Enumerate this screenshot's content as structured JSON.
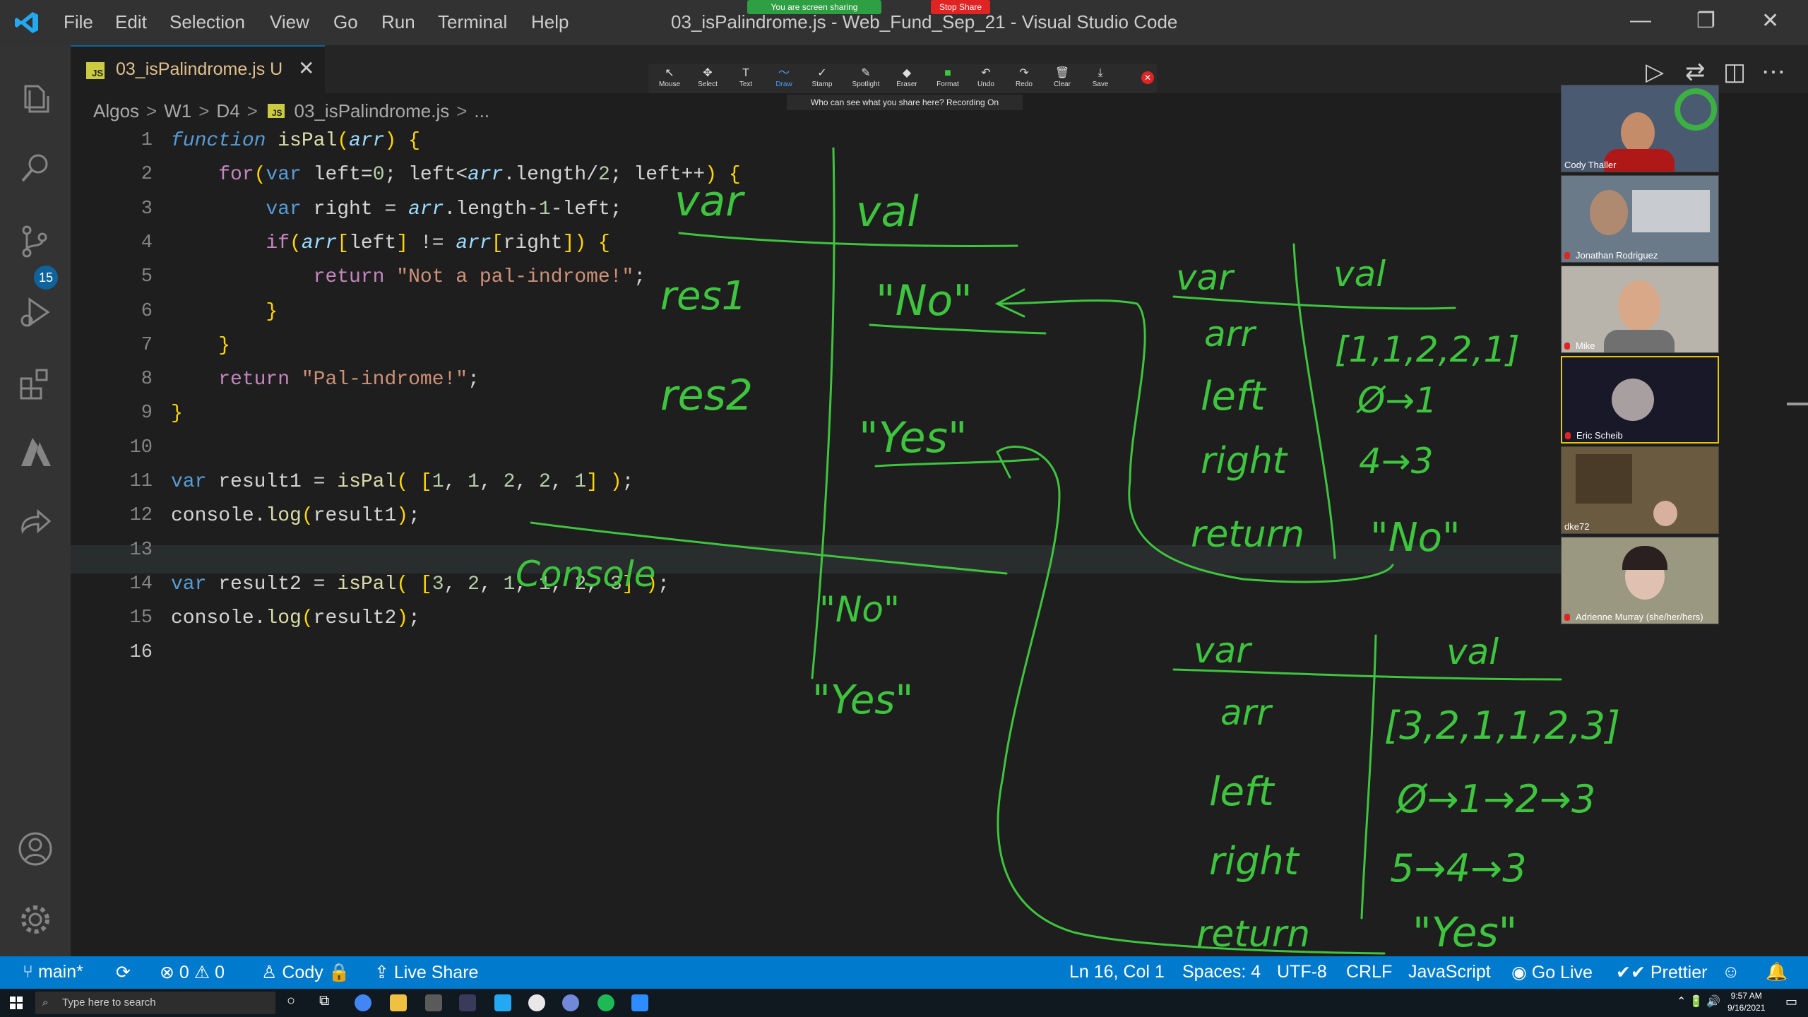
{
  "menu": [
    "File",
    "Edit",
    "Selection",
    "View",
    "Go",
    "Run",
    "Terminal",
    "Help"
  ],
  "window_title": "03_isPalindrome.js - Web_Fund_Sep_21 - Visual Studio Code",
  "window_controls": {
    "minimize": "—",
    "restore": "❐",
    "close": "✕"
  },
  "activity_badge": "15",
  "tab": {
    "name": "03_isPalindrome.js",
    "status": "U",
    "icon_text": "JS",
    "close": "✕"
  },
  "breadcrumbs": [
    "Algos",
    "W1",
    "D4",
    "03_isPalindrome.js",
    "..."
  ],
  "code_lines": [
    "function isPal(arr) {",
    "    for(var left=0; left<arr.length/2; left++) {",
    "        var right = arr.length-1-left;",
    "        if(arr[left] != arr[right]) {",
    "            return \"Not a pal-indrome!\";",
    "        }",
    "    }",
    "    return \"Pal-indrome!\";",
    "}",
    "",
    "var result1 = isPal( [1, 1, 2, 2, 1] );",
    "console.log(result1);",
    "",
    "var result2 = isPal( [3, 2, 1, 1, 2, 3] );",
    "console.log(result2);",
    ""
  ],
  "line_numbers": [
    "1",
    "2",
    "3",
    "4",
    "5",
    "6",
    "7",
    "8",
    "9",
    "10",
    "11",
    "12",
    "13",
    "14",
    "15",
    "16"
  ],
  "annotation_toolbar": [
    "Mouse",
    "Select",
    "Text",
    "Draw",
    "Stamp",
    "Spotlight",
    "Eraser",
    "Format",
    "Undo",
    "Redo",
    "Clear",
    "Save"
  ],
  "share_banner": "You are screen sharing",
  "stop_share": "Stop Share",
  "recording_notice": "Who can see what you share here? Recording On",
  "participants": [
    "Cody Thaller",
    "Jonathan Rodriguez",
    "Mike",
    "Eric Scheib",
    "dke72",
    "Adrienne Murray (she/her/hers)"
  ],
  "statusbar": {
    "branch": "main*",
    "errors": "0",
    "warnings": "0",
    "user": "Cody",
    "live_share": "Live Share",
    "position": "Ln 16, Col 1",
    "spaces": "Spaces: 4",
    "encoding": "UTF-8",
    "eol": "CRLF",
    "language": "JavaScript",
    "go_live": "Go Live",
    "prettier": "Prettier"
  },
  "taskbar": {
    "search_placeholder": "Type here to search",
    "time": "9:57 AM",
    "date": "9/16/2021"
  },
  "whiteboard_text": {
    "top_table_var": "var",
    "top_table_val": "val",
    "res1": "res1",
    "res1_val": "\"No\"",
    "res2": "res2",
    "res2_val": "\"Yes\"",
    "console": "Console",
    "console_out1": "\"No\"",
    "console_out2": "\"Yes\"",
    "t2_var": "var",
    "t2_val": "val",
    "t2_arr": "arr",
    "t2_arr_val": "[1,1,2,2,1]",
    "t2_left": "left",
    "t2_left_val": "Ø→1",
    "t2_right": "right",
    "t2_right_val": "4→3",
    "t2_return": "return",
    "t2_return_val": "\"No\"",
    "t3_var": "var",
    "t3_val": "val",
    "t3_arr": "arr",
    "t3_arr_val": "[3,2,1,1,2,3]",
    "t3_left": "left",
    "t3_left_val": "Ø→1→2→3",
    "t3_right": "right",
    "t3_right_val": "5→4→3",
    "t3_return": "return",
    "t3_return_val": "\"Yes\""
  }
}
